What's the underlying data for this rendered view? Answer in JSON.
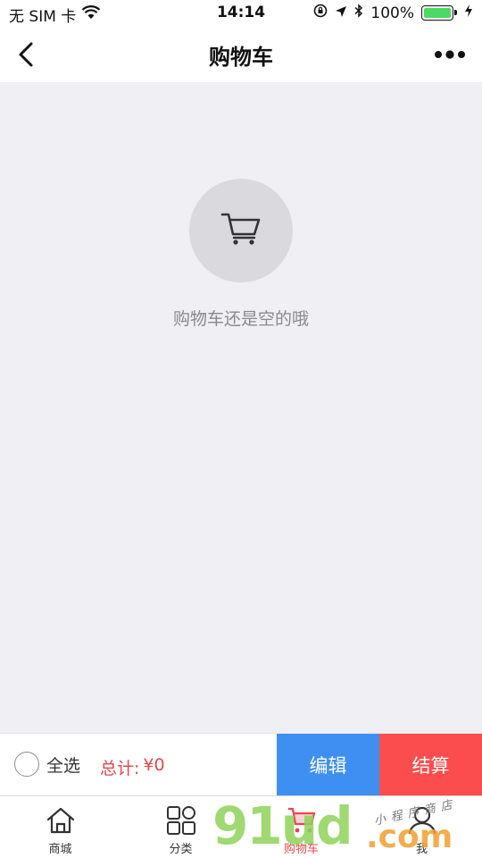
{
  "status_bar": {
    "carrier": "无 SIM 卡",
    "time": "14:14",
    "battery": "100%",
    "icons": [
      "wifi-icon",
      "rotation-lock-icon",
      "location-arrow-icon",
      "bluetooth-icon",
      "battery-icon",
      "charging-icon"
    ]
  },
  "nav": {
    "title": "购物车",
    "back_icon": "chevron-left-icon",
    "more_icon": "more-dots-icon"
  },
  "empty_state": {
    "icon": "cart-icon",
    "message": "购物车还是空的哦"
  },
  "action_bar": {
    "select_all_label": "全选",
    "total_label": "总计:",
    "total_value": "¥0",
    "edit_label": "编辑",
    "checkout_label": "结算",
    "colors": {
      "edit": "#3f8ff2",
      "checkout": "#fb4d4d",
      "total": "#e8474d"
    }
  },
  "tabs": [
    {
      "label": "商城",
      "icon": "home-icon",
      "active": false
    },
    {
      "label": "分类",
      "icon": "category-grid-icon",
      "active": false
    },
    {
      "label": "购物车",
      "icon": "cart-icon",
      "active": true
    },
    {
      "label": "我",
      "icon": "user-icon",
      "active": false
    }
  ],
  "watermark": {
    "main": "91ud",
    "suffix": ".com",
    "sub": "小程序商店"
  }
}
